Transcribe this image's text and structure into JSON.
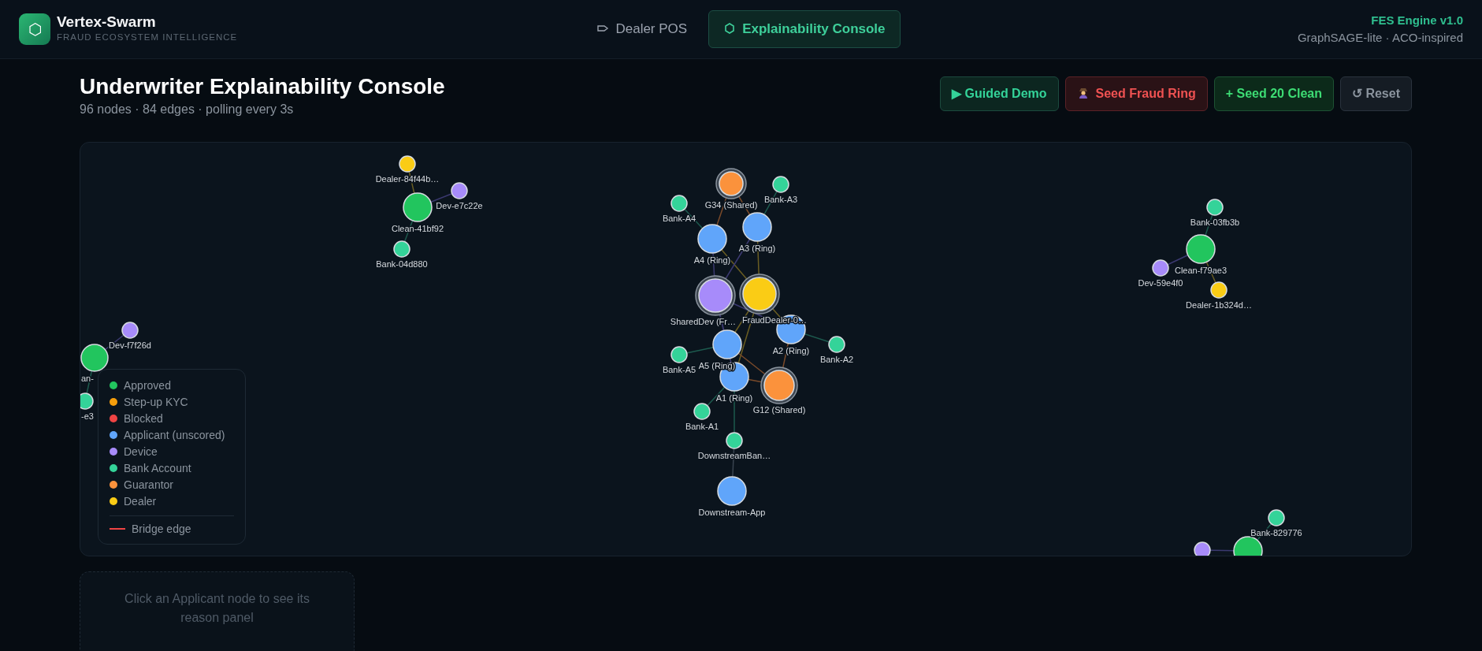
{
  "brand": {
    "logo": "⬡",
    "title": "Vertex-Swarm",
    "subtitle": "FRAUD ECOSYSTEM INTELLIGENCE"
  },
  "nav": [
    {
      "label": "Dealer POS",
      "selected": false
    },
    {
      "label": "Explainability Console",
      "selected": true
    }
  ],
  "engine": {
    "name": "FES Engine v1.0",
    "detail": "GraphSAGE-lite · ACO-inspired"
  },
  "page": {
    "title": "Underwriter Explainability Console",
    "stats": "96 nodes · 84 edges · polling every 3s"
  },
  "actions": [
    {
      "label": "Guided Demo",
      "icon": "▶",
      "kind": "demo"
    },
    {
      "label": "Seed Fraud Ring",
      "kind": "fraud"
    },
    {
      "label": "+ Seed 20 Clean",
      "kind": "clean"
    },
    {
      "label": "Reset",
      "icon": "↺",
      "kind": "reset"
    }
  ],
  "graph": {
    "nodes": [
      {
        "label": "Dealer-84f44b…",
        "kind": "dealer",
        "highlighted": false
      },
      {
        "label": "Clean-41bf92",
        "kind": "approved",
        "highlighted": false
      },
      {
        "label": "Dev-e7c22e",
        "kind": "device",
        "highlighted": false
      },
      {
        "label": "Bank-04d880",
        "kind": "bank",
        "highlighted": false
      },
      {
        "label": "Dev-f7f26d",
        "kind": "device",
        "highlighted": false
      },
      {
        "label": "an-",
        "kind": "approved",
        "highlighted": false
      },
      {
        "label": "-e3",
        "kind": "bank",
        "highlighted": false
      },
      {
        "label": "G34 (Shared)",
        "kind": "guarantor",
        "highlighted": true
      },
      {
        "label": "Bank-A3",
        "kind": "bank",
        "highlighted": false
      },
      {
        "label": "Bank-A4",
        "kind": "bank",
        "highlighted": false
      },
      {
        "label": "A4 (Ring)",
        "kind": "applicant",
        "highlighted": false
      },
      {
        "label": "A3 (Ring)",
        "kind": "applicant",
        "highlighted": false
      },
      {
        "label": "SharedDev (Fr…",
        "kind": "device",
        "highlighted": true
      },
      {
        "label": "FraudDealer-0…",
        "kind": "dealer",
        "highlighted": true
      },
      {
        "label": "A2 (Ring)",
        "kind": "applicant",
        "highlighted": false
      },
      {
        "label": "Bank-A2",
        "kind": "bank",
        "highlighted": false
      },
      {
        "label": "Bank-A5",
        "kind": "bank",
        "highlighted": false
      },
      {
        "label": "A5 (Ring)",
        "kind": "applicant",
        "highlighted": false
      },
      {
        "label": "A1 (Ring)",
        "kind": "applicant",
        "highlighted": false
      },
      {
        "label": "G12 (Shared)",
        "kind": "guarantor",
        "highlighted": true
      },
      {
        "label": "Bank-A1",
        "kind": "bank",
        "highlighted": false
      },
      {
        "label": "DownstreamBan…",
        "kind": "bank",
        "highlighted": false
      },
      {
        "label": "Downstream-App",
        "kind": "applicant",
        "highlighted": false
      },
      {
        "label": "Bank-03fb3b",
        "kind": "bank",
        "highlighted": false
      },
      {
        "label": "Clean-f79ae3",
        "kind": "approved",
        "highlighted": false
      },
      {
        "label": "Dev-59e4f0",
        "kind": "device",
        "highlighted": false
      },
      {
        "label": "Dealer-1b324d…",
        "kind": "dealer",
        "highlighted": false
      },
      {
        "label": "Bank-829776",
        "kind": "bank",
        "highlighted": false
      },
      {
        "kind": "approved",
        "highlighted": false
      },
      {
        "kind": "device",
        "highlighted": false
      }
    ]
  },
  "legend": {
    "items": [
      {
        "label": "Approved",
        "color": "#22c55e"
      },
      {
        "label": "Step-up KYC",
        "color": "#f59e0b"
      },
      {
        "label": "Blocked",
        "color": "#ef4444"
      },
      {
        "label": "Applicant (unscored)",
        "color": "#60a5fa"
      },
      {
        "label": "Device",
        "color": "#a78bfa"
      },
      {
        "label": "Bank Account",
        "color": "#34d399"
      },
      {
        "label": "Guarantor",
        "color": "#fb923c"
      },
      {
        "label": "Dealer",
        "color": "#facc15"
      }
    ],
    "bridge": {
      "label": "Bridge edge",
      "color": "#ef4444"
    }
  },
  "reason_panel": {
    "placeholder": "Click an Applicant node to see its reason panel"
  }
}
